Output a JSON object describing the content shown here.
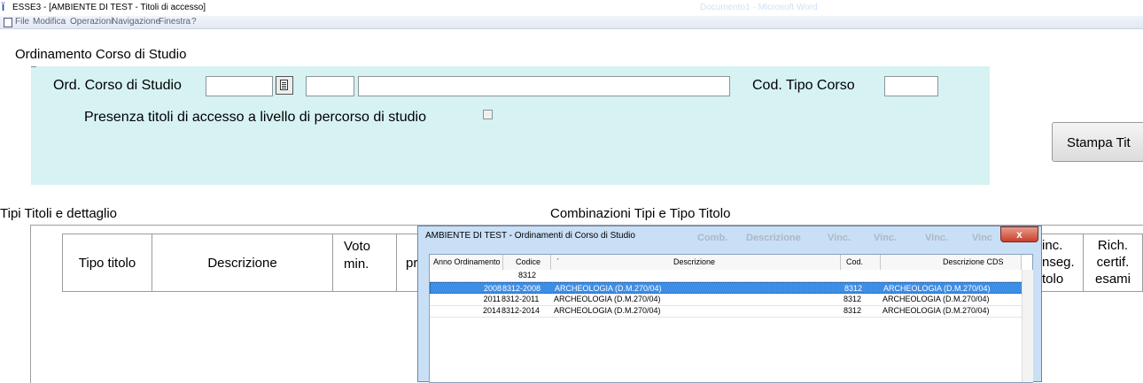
{
  "window": {
    "title": "ESSE3 - [AMBIENTE DI TEST - Titoli di accesso]",
    "faint_text": "Documento1 - Microsoft Word"
  },
  "menu": [
    "File",
    "Modifica",
    "Operazioni",
    "Navigazione",
    "Finestra",
    "?"
  ],
  "ordinamento": {
    "section_title": "Ordinamento Corso di Studio",
    "ord_label": "Ord. Corso di Studio",
    "cod_tipo_label": "Cod. Tipo Corso",
    "presenza_label": "Presenza titoli di accesso a livello di percorso di studio",
    "stampa_button": "Stampa Tit"
  },
  "tipi_titoli": {
    "section_title": "Tipi Titoli e dettaglio",
    "columns": [
      "Tipo titolo",
      "Descrizione",
      "Voto min.",
      "pr"
    ]
  },
  "combinazioni": {
    "section_title": "Combinazioni Tipi e Tipo Titolo",
    "columns": [
      "inc. nseg. tolo",
      "Rich. certif. esami"
    ]
  },
  "dialog": {
    "title": "AMBIENTE DI TEST - Ordinamenti di Corso di Studio",
    "close": "x",
    "behind_header": [
      "Comb.",
      "Descrizione",
      "Vinc.",
      "Vinc.",
      "Vinc.",
      "Vinc"
    ],
    "columns": [
      "Anno Ordinamento",
      "Codice",
      "Descrizione",
      "Cod. CDS",
      "Descrizione CDS"
    ],
    "sort_mark": "ˊ",
    "filter_value": "8312",
    "rows": [
      {
        "anno": "2008",
        "codice": "8312-2008",
        "descrizione": "ARCHEOLOGIA (D.M.270/04)",
        "cod_cds": "8312",
        "desc_cds": "ARCHEOLOGIA (D.M.270/04)"
      },
      {
        "anno": "2011",
        "codice": "8312-2011",
        "descrizione": "ARCHEOLOGIA (D.M.270/04)",
        "cod_cds": "8312",
        "desc_cds": "ARCHEOLOGIA (D.M.270/04)"
      },
      {
        "anno": "2014",
        "codice": "8312-2014",
        "descrizione": "ARCHEOLOGIA (D.M.270/04)",
        "cod_cds": "8312",
        "desc_cds": "ARCHEOLOGIA (D.M.270/04)"
      }
    ]
  }
}
